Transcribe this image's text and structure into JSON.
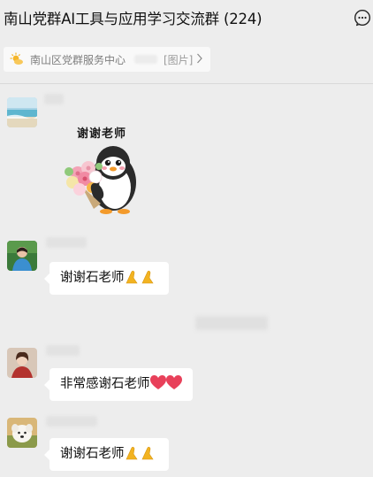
{
  "header": {
    "title": "南山党群AI工具与应用学习交流群 (224)",
    "more_icon": "chat-more-icon"
  },
  "pinned": {
    "icon": "sun-weather-icon",
    "name": "南山区党群服务中心",
    "tag": "[图片]",
    "arrow_icon": "chevron-right-icon"
  },
  "messages": [
    {
      "avatar": "beach-avatar",
      "type": "sticker",
      "sticker_text": "谢谢老师"
    },
    {
      "avatar": "woman-blue-avatar",
      "type": "text",
      "text": "谢谢石老师",
      "emoji": [
        "folded-hands-icon",
        "folded-hands-icon"
      ]
    },
    {
      "avatar": "woman-red-avatar",
      "type": "text",
      "text": "非常感谢石老师",
      "emoji": [
        "heart-icon",
        "heart-icon"
      ]
    },
    {
      "avatar": "dog-avatar",
      "type": "text",
      "text": "谢谢石老师",
      "emoji": [
        "folded-hands-icon",
        "folded-hands-icon"
      ]
    }
  ],
  "colors": {
    "background": "#ededed",
    "bubble": "#ffffff",
    "heart": "#e8405a",
    "hands": "#f2b321"
  }
}
